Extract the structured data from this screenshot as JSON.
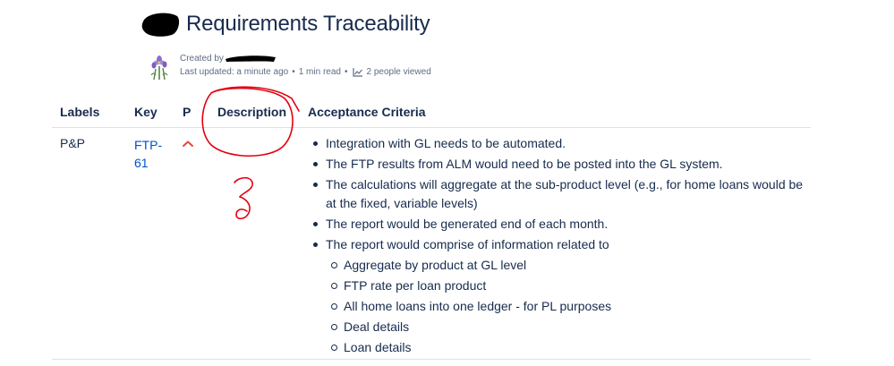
{
  "page": {
    "title": "Requirements Traceability",
    "created_prefix": "Created by",
    "last_updated": "Last updated: a minute ago",
    "read_time": "1 min read",
    "viewers": "2 people viewed",
    "separator": "•"
  },
  "table": {
    "headers": {
      "labels": "Labels",
      "key": "Key",
      "priority": "P",
      "description": "Description",
      "acceptance": "Acceptance Criteria"
    },
    "row": {
      "label": "P&P",
      "key_line1": "FTP-",
      "key_line2": "61",
      "priority_icon": "chevron-up-icon",
      "acceptance": {
        "items": [
          "Integration with GL needs to be automated.",
          "The FTP results from ALM would need to be posted into the GL system.",
          "The calculations will aggregate at the sub-product level (e.g., for home loans would be at the fixed, variable levels)",
          "The report would be generated end of each month.",
          "The report would comprise of information related to"
        ],
        "subitems": [
          "Aggregate by product at GL level",
          "FTP rate per loan product",
          "All home loans into one ledger - for PL purposes",
          "Deal details",
          "Loan details"
        ]
      }
    }
  },
  "annotation": {
    "mark": "?",
    "color": "#e3000f"
  },
  "colors": {
    "text": "#172b4d",
    "link": "#0052cc",
    "meta": "#5e6c84",
    "priority": "#e34935",
    "border": "#dfe1e6"
  }
}
